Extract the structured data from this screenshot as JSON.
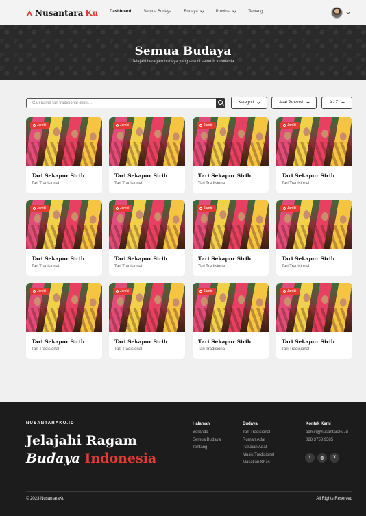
{
  "nav": {
    "brand_main": "Nusantara",
    "brand_accent": "Ku",
    "links": [
      {
        "label": "Dashboard",
        "dropdown": false,
        "active": true
      },
      {
        "label": "Semua Budaya",
        "dropdown": false,
        "active": false
      },
      {
        "label": "Budaya",
        "dropdown": true,
        "active": false
      },
      {
        "label": "Provinsi",
        "dropdown": true,
        "active": false
      },
      {
        "label": "Tentang",
        "dropdown": false,
        "active": false
      }
    ]
  },
  "hero": {
    "title": "Semua Budaya",
    "subtitle": "Jelajahi beragam budaya yang ada di seluruh Indonesia"
  },
  "filters": {
    "search_placeholder": "Cari nama tari tradisional disini...",
    "kategori": "Kategori",
    "provinsi": "Asal Provinsi",
    "sort": "A - Z"
  },
  "cards": [
    {
      "badge": "Jambi",
      "title": "Tari Sekapur Sirih",
      "category": "Tari Tradisional"
    },
    {
      "badge": "Jambi",
      "title": "Tari Sekapur Sirih",
      "category": "Tari Tradisional"
    },
    {
      "badge": "Jambi",
      "title": "Tari Sekapur Sirih",
      "category": "Tari Tradisional"
    },
    {
      "badge": "Jambi",
      "title": "Tari Sekapur Sirih",
      "category": "Tari Tradisional"
    },
    {
      "badge": "Jambi",
      "title": "Tari Sekapur Sirih",
      "category": "Tari Tradisional"
    },
    {
      "badge": "Jambi",
      "title": "Tari Sekapur Sirih",
      "category": "Tari Tradisional"
    },
    {
      "badge": "Jambi",
      "title": "Tari Sekapur Sirih",
      "category": "Tari Tradisional"
    },
    {
      "badge": "Jambi",
      "title": "Tari Sekapur Sirih",
      "category": "Tari Tradisional"
    },
    {
      "badge": "Jambi",
      "title": "Tari Sekapur Sirih",
      "category": "Tari Tradisional"
    },
    {
      "badge": "Jambi",
      "title": "Tari Sekapur Sirih",
      "category": "Tari Tradisional"
    },
    {
      "badge": "Jambi",
      "title": "Tari Sekapur Sirih",
      "category": "Tari Tradisional"
    },
    {
      "badge": "Jambi",
      "title": "Tari Sekapur Sirih",
      "category": "Tari Tradisional"
    }
  ],
  "footer": {
    "brand": "NUSANTARAKU.ID",
    "headline_1": "Jelajahi Ragam",
    "headline_2_italic": "Budaya",
    "headline_2_red": "Indonesia",
    "halaman": {
      "title": "Halaman",
      "items": [
        "Beranda",
        "Semua Budaya",
        "Tentang"
      ]
    },
    "budaya": {
      "title": "Budaya",
      "items": [
        "Tari Tradisional",
        "Rumah Adat",
        "Pakaian Adat",
        "Musik Tradisional",
        "Masakan Khas"
      ]
    },
    "kontak": {
      "title": "Kontak Kami",
      "email": "admin@nusantaraku.id",
      "phone": "028 3753 9385"
    },
    "social": [
      "f",
      "◎",
      "X"
    ],
    "copyright": "© 2023 NusantaraKu",
    "rights": "All Rights Reserved"
  },
  "colors": {
    "accent": "#e53935",
    "dark": "#1c1c1c",
    "hero": "#2a2a2a"
  }
}
